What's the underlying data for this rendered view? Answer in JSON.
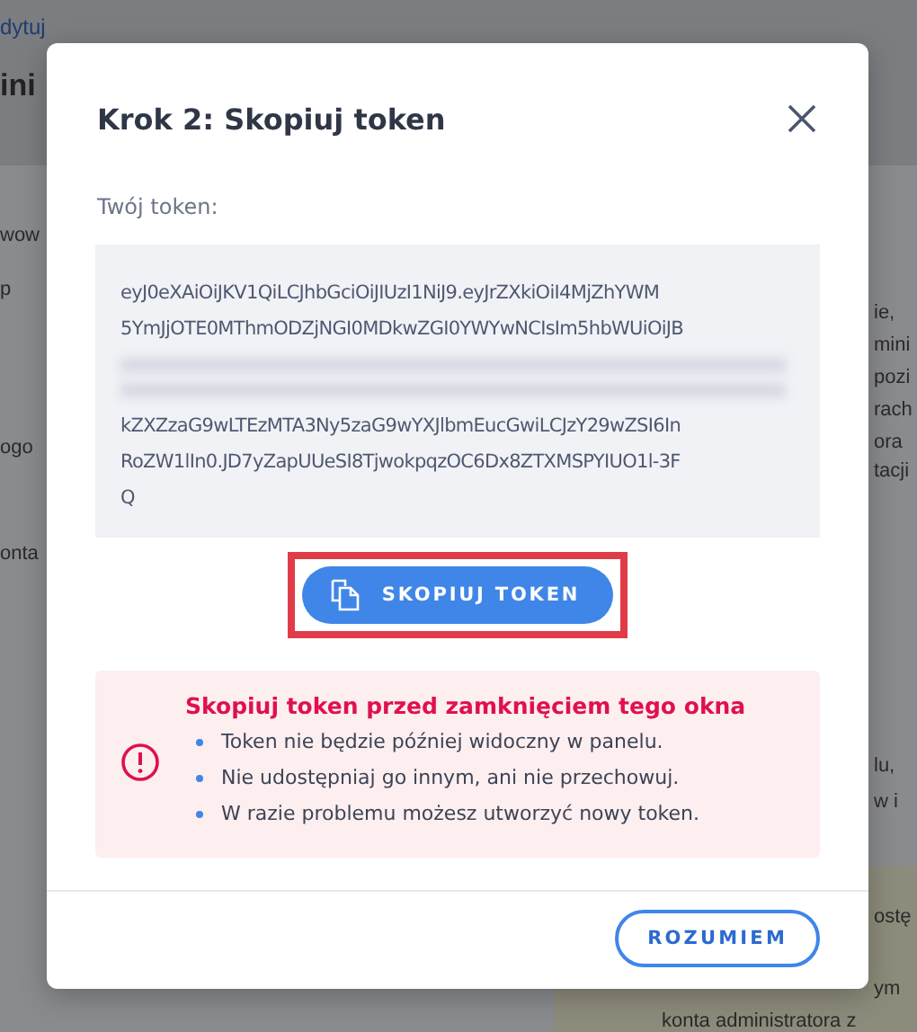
{
  "background": {
    "link": "dytuj",
    "heading": "ini",
    "left_fragments": [
      "wow",
      "p",
      "ogo",
      "onta"
    ],
    "right_fragments": [
      "ie,",
      "mini",
      "pozi",
      "rach",
      "ora",
      "tacji",
      "lu,",
      "w i",
      "ostę",
      "ym",
      "konta administratora z"
    ]
  },
  "modal": {
    "title": "Krok 2: Skopiuj token",
    "token_label": "Twój token:",
    "token_lines": [
      {
        "kind": "text",
        "text": "eyJ0eXAiOiJKV1QiLCJhbGciOiJIUzI1NiJ9.eyJrZXkiOiI4MjZhYWM"
      },
      {
        "kind": "text",
        "text": "5YmJjOTE0MThmODZjNGI0MDkwZGI0YWYwNCIsIm5hbWUiOiJB"
      },
      {
        "kind": "blurred"
      },
      {
        "kind": "blurred"
      },
      {
        "kind": "text",
        "text": "kZXZzaG9wLTEzMTA3Ny5zaG9wYXJlbmEucGwiLCJzY29wZSI6In"
      },
      {
        "kind": "text",
        "text": "RoZW1lIn0.JD7yZapUUeSI8TjwokpqzOC6Dx8ZTXMSPYIUO1l-3F"
      },
      {
        "kind": "text",
        "text": "Q"
      }
    ],
    "copy_button": {
      "label": "SKOPIUJ TOKEN",
      "highlighted": true
    },
    "warning": {
      "title": "Skopiuj token przed zamknięciem tego okna",
      "items": [
        "Token nie będzie później widoczny w panelu.",
        "Nie udostępniaj go innym, ani nie przechowuj.",
        "W razie problemu możesz utworzyć nowy token."
      ]
    },
    "confirm_button": "ROZUMIEM"
  }
}
